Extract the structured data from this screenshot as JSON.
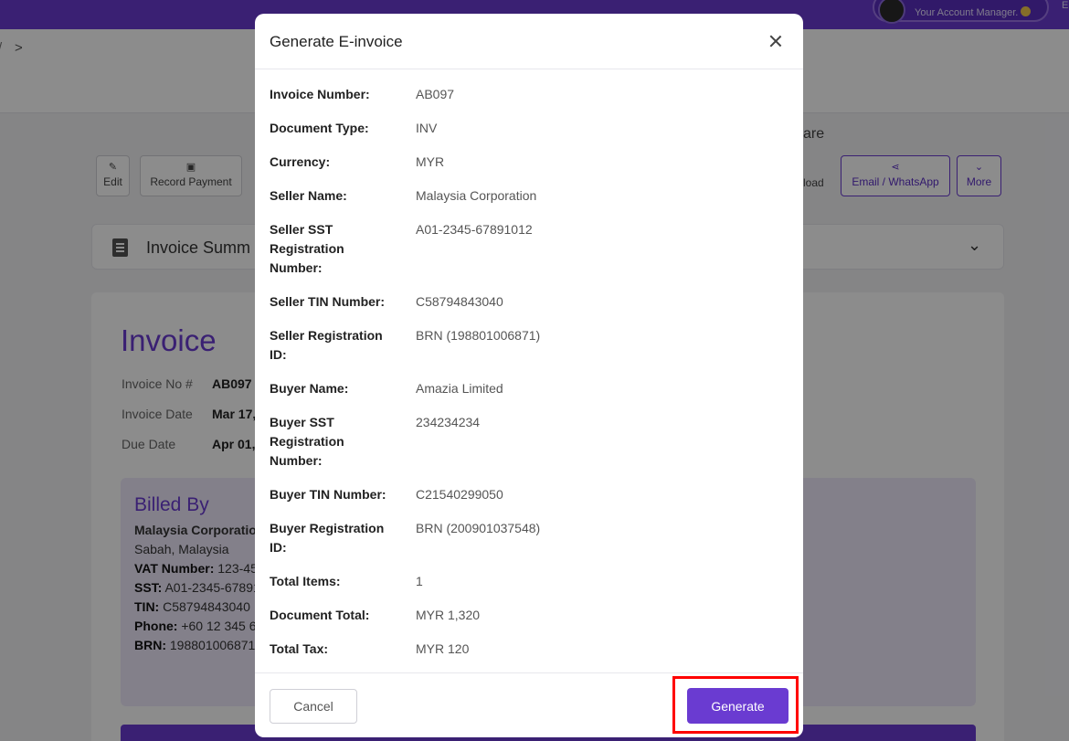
{
  "header": {
    "account_subtitle": "Your Account Manager.",
    "edge_text": "E"
  },
  "breadcrumb": {
    "prev_glyph": "/",
    "chevron": ">"
  },
  "toolbar": {
    "edit_label": "Edit",
    "record_payment_label": "Record Payment",
    "share_label": "are",
    "download_label": "load",
    "email_whatsapp_label": "Email / WhatsApp",
    "more_label": "More"
  },
  "summary": {
    "title": "Invoice Summ"
  },
  "invoice": {
    "title": "Invoice",
    "meta": [
      {
        "label": "Invoice No #",
        "value": "AB097"
      },
      {
        "label": "Invoice Date",
        "value": "Mar 17,"
      },
      {
        "label": "Due Date",
        "value": "Apr 01,"
      }
    ],
    "billed_by": {
      "title": "Billed By",
      "company": "Malaysia Corporation",
      "address": "Sabah, Malaysia",
      "lines": [
        {
          "label": "VAT Number:",
          "value": " 123-45"
        },
        {
          "label": "SST:",
          "value": " A01-2345-67891"
        },
        {
          "label": "TIN:",
          "value": " C58794843040"
        },
        {
          "label": "Phone:",
          "value": " +60 12 345 6"
        },
        {
          "label": "BRN:",
          "value": " 198801006871"
        }
      ]
    }
  },
  "modal": {
    "title": "Generate E-invoice",
    "fields": [
      {
        "label": "Invoice Number:",
        "value": "AB097"
      },
      {
        "label": "Document Type:",
        "value": "INV"
      },
      {
        "label": "Currency:",
        "value": "MYR"
      },
      {
        "label": "Seller Name:",
        "value": "Malaysia Corporation"
      },
      {
        "label": "Seller SST Registration Number:",
        "value": "A01-2345-67891012"
      },
      {
        "label": "Seller TIN Number:",
        "value": "C58794843040"
      },
      {
        "label": "Seller Registration ID:",
        "value": "BRN (198801006871)"
      },
      {
        "label": "Buyer Name:",
        "value": "Amazia Limited"
      },
      {
        "label": "Buyer SST Registration Number:",
        "value": "234234234"
      },
      {
        "label": "Buyer TIN Number:",
        "value": "C21540299050"
      },
      {
        "label": "Buyer Registration ID:",
        "value": "BRN (200901037548)"
      },
      {
        "label": "Total Items:",
        "value": "1"
      },
      {
        "label": "Document Total:",
        "value": "MYR 1,320"
      },
      {
        "label": "Total Tax:",
        "value": "MYR 120"
      }
    ],
    "cancel_label": "Cancel",
    "generate_label": "Generate"
  },
  "colors": {
    "brand": "#6a3bd1",
    "highlight": "#ff0000"
  }
}
